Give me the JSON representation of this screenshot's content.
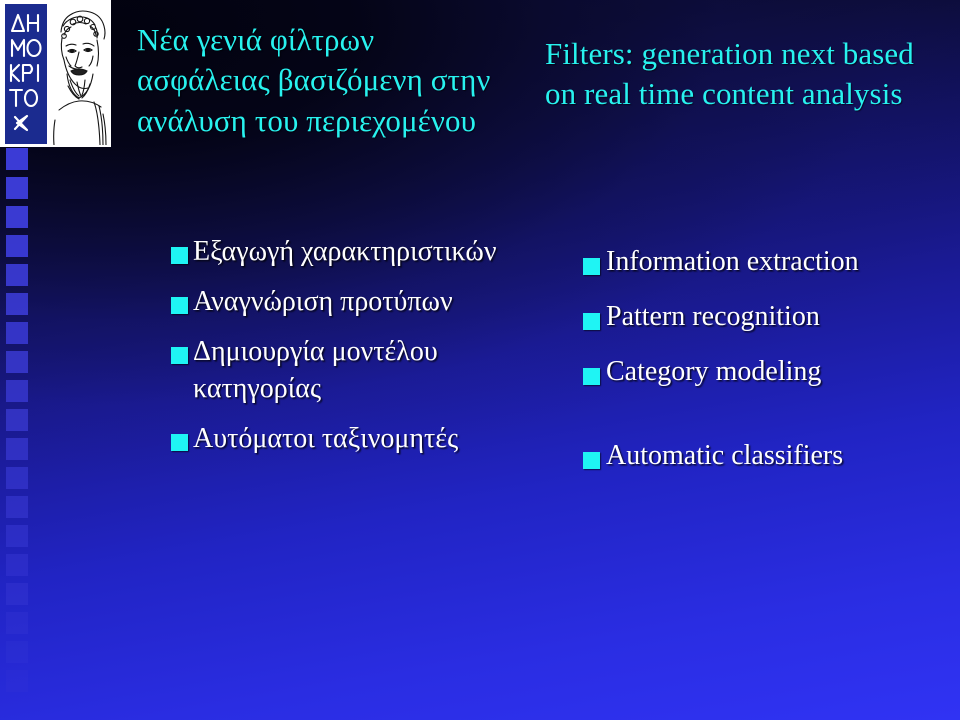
{
  "slide": {
    "logo": {
      "institute_name": "ΔΗΜΟΚΡΙΤΟΣ",
      "portrait_alt": "democritus-portrait",
      "band_color": "#1b2b8f",
      "panel_color": "#ffffff"
    },
    "colors": {
      "title": "#28f2ef",
      "bullet_text": "#ffffff",
      "bullet_marker": "#1ff4f4",
      "background_top": "#07071a",
      "background_bottom": "#3033f4",
      "strip_square": "#3b3bd6"
    },
    "left_column": {
      "title": "Νέα γενιά φίλτρων ασφάλειας βασιζόμενη στην ανάλυση του περιεχομένου",
      "bullets": [
        "Εξαγωγή χαρακτηριστικών",
        "Αναγνώριση προτύπων",
        "Δημιουργία μοντέλου κατηγορίας",
        "Αυτόματοι ταξινομητές"
      ]
    },
    "right_column": {
      "title": "Filters: generation next based on real time content analysis",
      "bullets": [
        "Information extraction",
        "Pattern recognition",
        "Category modeling",
        "Automatic classifiers"
      ]
    }
  }
}
